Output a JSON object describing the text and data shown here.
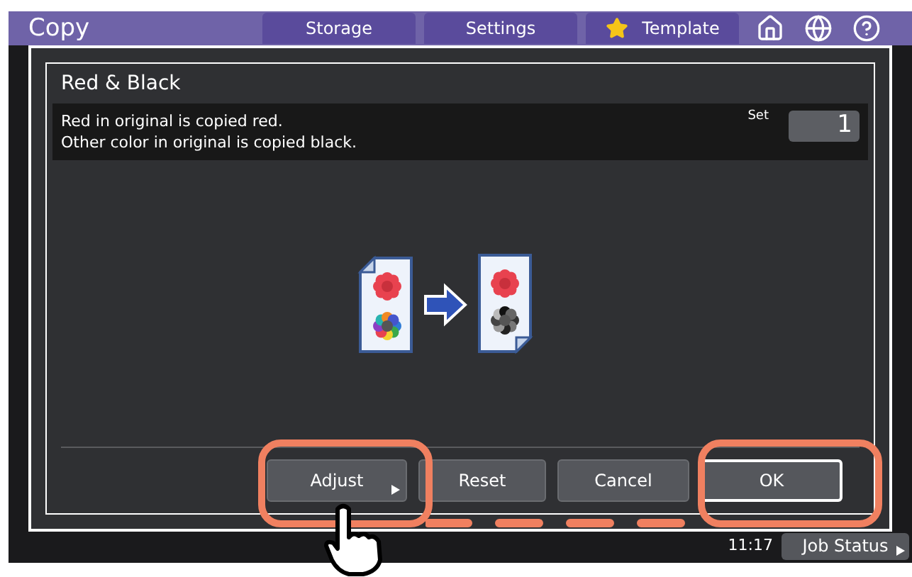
{
  "header": {
    "title": "Copy",
    "tabs": [
      {
        "label": "Storage",
        "kind": "plain"
      },
      {
        "label": "Settings",
        "kind": "plain"
      },
      {
        "label": "Template",
        "kind": "star"
      }
    ]
  },
  "dialog": {
    "title": "Red & Black",
    "message": [
      "Red in original is copied red.",
      "Other color in original is copied black."
    ],
    "set_label": "Set",
    "set_value": "1",
    "buttons": [
      {
        "label": "Adjust",
        "kind": "menu",
        "default": false,
        "annotated": true
      },
      {
        "label": "Reset",
        "kind": "plain",
        "default": false,
        "annotated": false
      },
      {
        "label": "Cancel",
        "kind": "plain",
        "default": false,
        "annotated": false
      },
      {
        "label": "OK",
        "kind": "plain",
        "default": true,
        "annotated": true
      }
    ]
  },
  "status_bar": {
    "time": "11:17",
    "job_status": "Job Status"
  }
}
